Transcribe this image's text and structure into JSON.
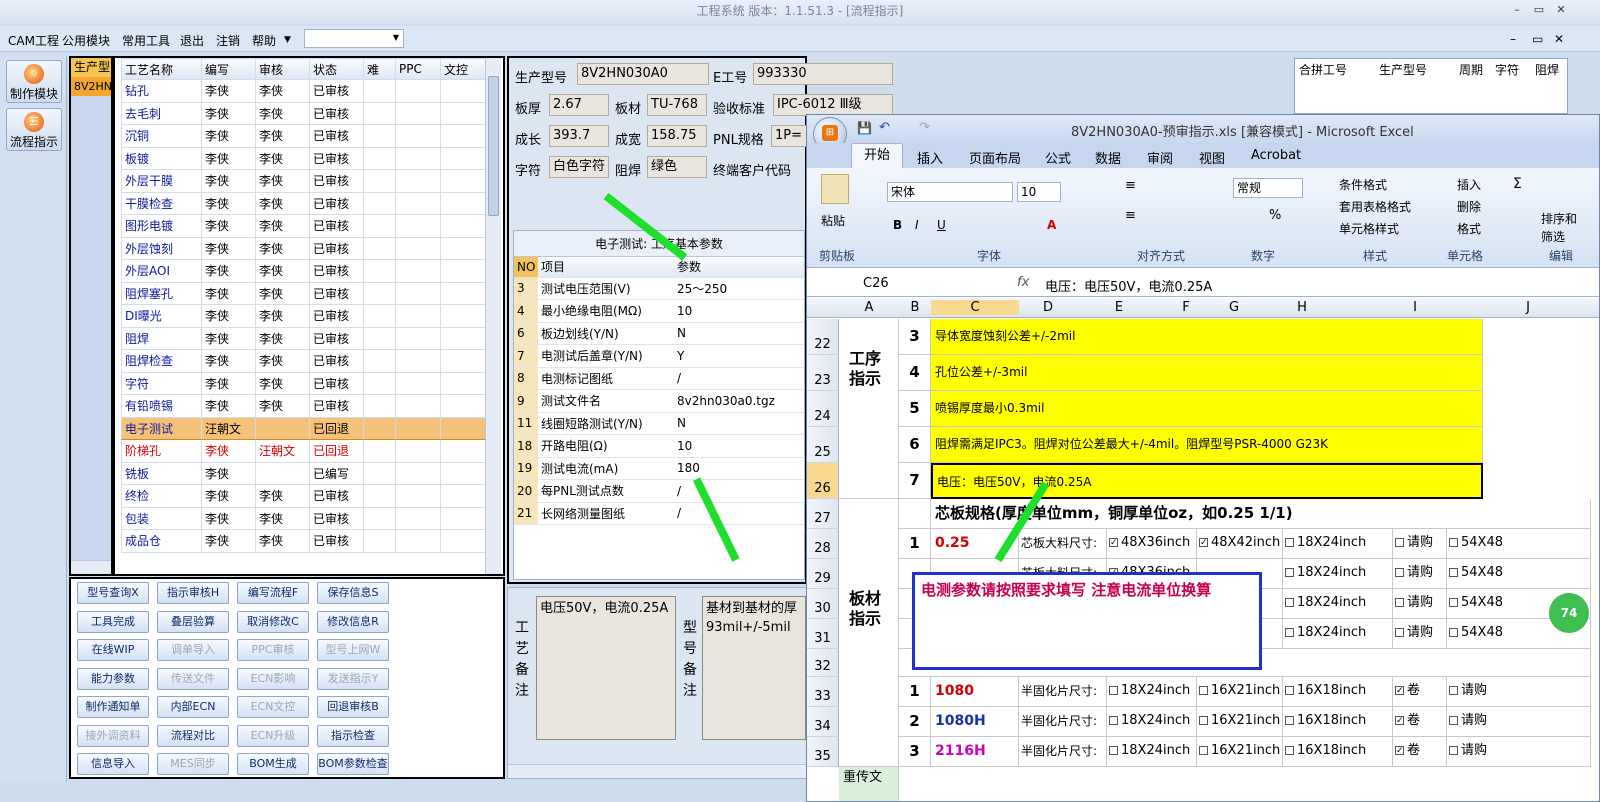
{
  "window": {
    "title": "工程系统  版本：1.1.51.3 - [流程指示]"
  },
  "menu": [
    "CAM工程",
    "公用模块",
    "常用工具",
    "退出",
    "注销",
    "帮助"
  ],
  "left_nav": [
    {
      "label": "制作模块"
    },
    {
      "label": "流程指示"
    }
  ],
  "product_column": {
    "header": "生产型",
    "value": "8V2HN0"
  },
  "process_table": {
    "headers": [
      "工艺名称",
      "编写",
      "审核",
      "状态",
      "难",
      "PPC",
      "文控"
    ],
    "rows": [
      [
        "钻孔",
        "李侠",
        "李侠",
        "已审核"
      ],
      [
        "去毛刺",
        "李侠",
        "李侠",
        "已审核"
      ],
      [
        "沉铜",
        "李侠",
        "李侠",
        "已审核"
      ],
      [
        "板镀",
        "李侠",
        "李侠",
        "已审核"
      ],
      [
        "外层干膜",
        "李侠",
        "李侠",
        "已审核"
      ],
      [
        "干膜检查",
        "李侠",
        "李侠",
        "已审核"
      ],
      [
        "图形电镀",
        "李侠",
        "李侠",
        "已审核"
      ],
      [
        "外层蚀刻",
        "李侠",
        "李侠",
        "已审核"
      ],
      [
        "外层AOI",
        "李侠",
        "李侠",
        "已审核"
      ],
      [
        "阻焊塞孔",
        "李侠",
        "李侠",
        "已审核"
      ],
      [
        "DI曝光",
        "李侠",
        "李侠",
        "已审核"
      ],
      [
        "阻焊",
        "李侠",
        "李侠",
        "已审核"
      ],
      [
        "阻焊检查",
        "李侠",
        "李侠",
        "已审核"
      ],
      [
        "字符",
        "李侠",
        "李侠",
        "已审核"
      ],
      [
        "有铅喷锡",
        "李侠",
        "李侠",
        "已审核"
      ],
      [
        "电子测试",
        "汪朝文",
        "",
        "已回退"
      ],
      [
        "阶梯孔",
        "李侠",
        "汪朝文",
        "已回退"
      ],
      [
        "铣板",
        "李侠",
        "",
        "已编写"
      ],
      [
        "终检",
        "李侠",
        "李侠",
        "已审核"
      ],
      [
        "包装",
        "李侠",
        "李侠",
        "已审核"
      ],
      [
        "成品仓",
        "李侠",
        "李侠",
        "已审核"
      ]
    ]
  },
  "function_buttons": [
    [
      "型号查询X",
      "指示审核H",
      "编写流程F",
      "保存信息S"
    ],
    [
      "工具完成",
      "叠层验算",
      "取消修改C",
      "修改信息R"
    ],
    [
      "在线WIP",
      "调单导入",
      "PPC审核",
      "型号上网W"
    ],
    [
      "能力参数",
      "传送文件",
      "ECN影响",
      "发送指示Y"
    ],
    [
      "制作通知单",
      "内部ECN",
      "ECN文控",
      "回退审核B"
    ],
    [
      "接外调资料",
      "流程对比",
      "ECN升级",
      "指示检查"
    ],
    [
      "信息导入",
      "MES同步",
      "BOM生成",
      "BOM参数检查"
    ]
  ],
  "detail": {
    "prod_label": "生产型号",
    "prod": "8V2HN030A0",
    "e_label": "E工号",
    "e": "993330",
    "thick_label": "板厚",
    "thick": "2.67",
    "mat_label": "板材",
    "mat": "TU-768",
    "std_label": "验收标准",
    "std": "IPC-6012 Ⅲ级",
    "len_label": "成长",
    "len": "393.7",
    "wid_label": "成宽",
    "wid": "158.75",
    "pnl_label": "PNL规格",
    "pnl": "1P=",
    "char_label": "字符",
    "char": "白色字符",
    "mask_label": "阻焊",
    "mask": "绿色",
    "cust_label": "终端客户代码"
  },
  "param_table": {
    "title": "电子测试: 工序基本参数",
    "headers": [
      "NO",
      "项目",
      "参数"
    ],
    "rows": [
      [
        "3",
        "测试电压范围(V)",
        "25～250"
      ],
      [
        "4",
        "最小绝缘电阻(MΩ)",
        "10"
      ],
      [
        "6",
        "板边划线(Y/N)",
        "N"
      ],
      [
        "7",
        "电测试后盖章(Y/N)",
        "Y"
      ],
      [
        "8",
        "电测标记图纸",
        "/"
      ],
      [
        "9",
        "测试文件名",
        "8v2hn030a0.tgz"
      ],
      [
        "11",
        "线圈短路测试(Y/N)",
        "N"
      ],
      [
        "18",
        "开路电阻(Ω)",
        "10"
      ],
      [
        "19",
        "测试电流(mA)",
        "180"
      ],
      [
        "20",
        "每PNL测试点数",
        "/"
      ],
      [
        "21",
        "长网络测量图纸",
        "/"
      ]
    ]
  },
  "notes": {
    "process_label": "工艺备注",
    "process": "电压50V，电流0.25A",
    "model_label": "型号备注",
    "model": "基材到基材的厚 93mil+/-5mil"
  },
  "merge_headers": [
    "合拼工号",
    "生产型号",
    "周期",
    "字符",
    "阻焊"
  ],
  "excel": {
    "title": "8V2HN030A0-预审指示.xls [兼容模式] - Microsoft Excel",
    "tabs": [
      "开始",
      "插入",
      "页面布局",
      "公式",
      "数据",
      "审阅",
      "视图",
      "Acrobat"
    ],
    "groups": [
      "剪贴板",
      "字体",
      "对齐方式",
      "数字",
      "样式",
      "单元格",
      "编辑"
    ],
    "font_name": "宋体",
    "font_size": "10",
    "number_format": "常规",
    "paste": "粘贴",
    "styles": [
      "条件格式",
      "套用表格格式",
      "单元格样式"
    ],
    "cells_ops": [
      "插入",
      "删除",
      "格式"
    ],
    "edit_ops": [
      "排序和",
      "筛选"
    ],
    "cell_ref": "C26",
    "fx": "fx",
    "formula": "电压：电压50V，电流0.25A",
    "cols": [
      "A",
      "B",
      "C",
      "D",
      "E",
      "F",
      "G",
      "H",
      "I",
      "J"
    ],
    "row_numbers": [
      "22",
      "23",
      "24",
      "25",
      "26",
      "27",
      "28",
      "29",
      "30",
      "31",
      "32",
      "33",
      "34",
      "35"
    ],
    "section1": "工序指示",
    "section2": "板材指示",
    "section3": "重传文",
    "proc_rows": [
      [
        "3",
        "导体宽度蚀刻公差+/-2mil"
      ],
      [
        "4",
        "孔位公差+/-3mil"
      ],
      [
        "5",
        "喷锡厚度最小0.3mil"
      ],
      [
        "6",
        "阻焊需满足IPC3。阻焊对位公差最大+/-4mil。阻焊型号PSR-4000 G23K"
      ],
      [
        "7",
        "电压：电压50V，电流0.25A"
      ]
    ],
    "core_title": "芯板规格(厚度单位mm，铜厚单位oz，如0.25 1/1)",
    "core_rows": [
      [
        "1",
        "0.25",
        "芯板大料尺寸:",
        "48X36inch",
        "48X42inch",
        "18X24inch",
        "请购",
        "54X48"
      ],
      [
        "",
        "",
        "芯板大料尺寸:",
        "48X36inch",
        "",
        "18X24inch",
        "请购",
        "54X48"
      ],
      [
        "",
        "",
        "",
        "",
        "",
        "18X24inch",
        "请购",
        "54X48"
      ],
      [
        "",
        "",
        "",
        "",
        "",
        "18X24inch",
        "请购",
        "54X48"
      ]
    ],
    "pp_rows": [
      [
        "1",
        "1080",
        "半固化片尺寸:",
        "18X24inch",
        "16X21inch",
        "16X18inch",
        "卷",
        "请购"
      ],
      [
        "2",
        "1080H",
        "半固化片尺寸:",
        "18X24inch",
        "16X21inch",
        "16X18inch",
        "卷",
        "请购"
      ],
      [
        "3",
        "2116H",
        "半固化片尺寸:",
        "18X24inch",
        "16X21inch",
        "16X18inch",
        "卷",
        "请购"
      ]
    ],
    "pp_colors": [
      "#d40000",
      "#1a2fb0",
      "#d000c0"
    ],
    "badge": "74"
  },
  "callout": {
    "text": "电测参数请按照要求填写   注意电流单位换算"
  }
}
